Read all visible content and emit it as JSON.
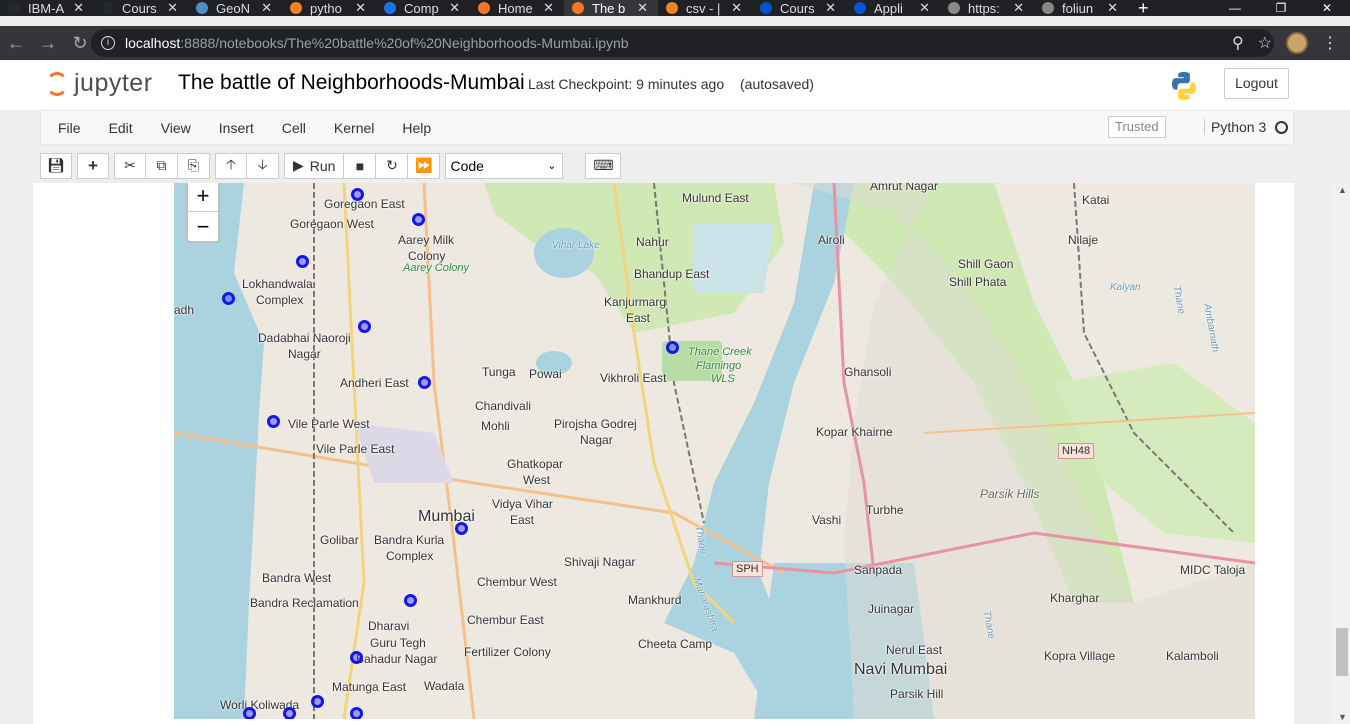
{
  "browser": {
    "tabs": [
      {
        "title": "IBM-A",
        "icon": "github-icon",
        "color": "#24292e"
      },
      {
        "title": "Cours",
        "icon": "github-icon",
        "color": "#24292e"
      },
      {
        "title": "GeoN",
        "icon": "globe-icon",
        "color": "#4a90c2"
      },
      {
        "title": "pytho",
        "icon": "stackoverflow-icon",
        "color": "#f48024"
      },
      {
        "title": "Comp",
        "icon": "h-icon",
        "color": "#1a73e8"
      },
      {
        "title": "Home",
        "icon": "jupyter-icon",
        "color": "#f37726"
      },
      {
        "title": "The b",
        "icon": "notebook-icon",
        "color": "#f37726"
      },
      {
        "title": "csv - |",
        "icon": "stackoverflow-icon",
        "color": "#f48024"
      },
      {
        "title": "Cours",
        "icon": "coursera-icon",
        "color": "#0056d2"
      },
      {
        "title": "Appli",
        "icon": "coursera-icon",
        "color": "#0056d2"
      },
      {
        "title": "https:",
        "icon": "globe-icon",
        "color": "#888888"
      },
      {
        "title": "foliun",
        "icon": "globe-icon",
        "color": "#888888"
      }
    ],
    "active_tab": 6,
    "url_host": "localhost",
    "url_path": ":8888/notebooks/The%20battle%20of%20Neighborhoods-Mumbai.ipynb"
  },
  "jupyter": {
    "logo_text": "jupyter",
    "notebook_title": "The battle of Neighborhoods-Mumbai",
    "checkpoint": "Last Checkpoint: 9 minutes ago",
    "autosave": "(autosaved)",
    "logout": "Logout",
    "menu": [
      "File",
      "Edit",
      "View",
      "Insert",
      "Cell",
      "Kernel",
      "Help"
    ],
    "trusted": "Trusted",
    "kernel": "Python 3",
    "run_label": "Run",
    "cell_type": "Code"
  },
  "map": {
    "zoom_in": "+",
    "zoom_out": "−",
    "labels": [
      {
        "t": "Goregaon East"
      },
      {
        "t": "Goregaon West"
      },
      {
        "t": "Aarey Milk"
      },
      {
        "t": "Colony"
      },
      {
        "t": "Aarey Colony"
      },
      {
        "t": "Vihar Lake"
      },
      {
        "t": "Mulund East"
      },
      {
        "t": "Amrut Nagar"
      },
      {
        "t": "Katai"
      },
      {
        "t": "Nahur"
      },
      {
        "t": "Airoli"
      },
      {
        "t": "Nilaje"
      },
      {
        "t": "Bhandup East"
      },
      {
        "t": "Lokhandwala"
      },
      {
        "t": "Complex"
      },
      {
        "t": "Shill Gaon"
      },
      {
        "t": "Shill Phata"
      },
      {
        "t": "Kalyan"
      },
      {
        "t": "Kanjurmarg"
      },
      {
        "t": "East"
      },
      {
        "t": "adh"
      },
      {
        "t": "Dadabhai Naoroji"
      },
      {
        "t": "Nagar"
      },
      {
        "t": "Thane Creek"
      },
      {
        "t": "Flamingo"
      },
      {
        "t": "WLS"
      },
      {
        "t": "Tunga"
      },
      {
        "t": "Powai"
      },
      {
        "t": "Vikhroli East"
      },
      {
        "t": "Ghansoli"
      },
      {
        "t": "Andheri East"
      },
      {
        "t": "Chandivali"
      },
      {
        "t": "Mohli"
      },
      {
        "t": "Pirojsha Godrej"
      },
      {
        "t": "Nagar"
      },
      {
        "t": "Vile Parle West"
      },
      {
        "t": "Vile Parle East"
      },
      {
        "t": "Kopar Khairne"
      },
      {
        "t": "NH48"
      },
      {
        "t": "Ghatkopar"
      },
      {
        "t": "West"
      },
      {
        "t": "Parsik Hills"
      },
      {
        "t": "Vidya Vihar"
      },
      {
        "t": "East"
      },
      {
        "t": "Turbhe"
      },
      {
        "t": "Mumbai"
      },
      {
        "t": "Vashi"
      },
      {
        "t": "Golibar"
      },
      {
        "t": "Bandra Kurla"
      },
      {
        "t": "Complex"
      },
      {
        "t": "Shivaji Nagar"
      },
      {
        "t": "SPH"
      },
      {
        "t": "Sanpada"
      },
      {
        "t": "MIDC Taloja"
      },
      {
        "t": "Bandra West"
      },
      {
        "t": "Chembur West"
      },
      {
        "t": "Mankhurd"
      },
      {
        "t": "Kharghar"
      },
      {
        "t": "Bandra Reclamation"
      },
      {
        "t": "Juinagar"
      },
      {
        "t": "Dharavi"
      },
      {
        "t": "Chembur East"
      },
      {
        "t": "Guru Tegh"
      },
      {
        "t": "Bahadur Nagar"
      },
      {
        "t": "Cheeta Camp"
      },
      {
        "t": "Fertilizer Colony"
      },
      {
        "t": "Nerul East"
      },
      {
        "t": "Kopra Village"
      },
      {
        "t": "Kalamboli"
      },
      {
        "t": "Navi Mumbai"
      },
      {
        "t": "Matunga East"
      },
      {
        "t": "Wadala"
      },
      {
        "t": "Parsik Hill"
      },
      {
        "t": "Worli Koliwada"
      },
      {
        "t": "Maharashtra"
      },
      {
        "t": "Thane"
      },
      {
        "t": "Thane"
      },
      {
        "t": "Ambarnath"
      },
      {
        "t": "Thane"
      }
    ]
  }
}
